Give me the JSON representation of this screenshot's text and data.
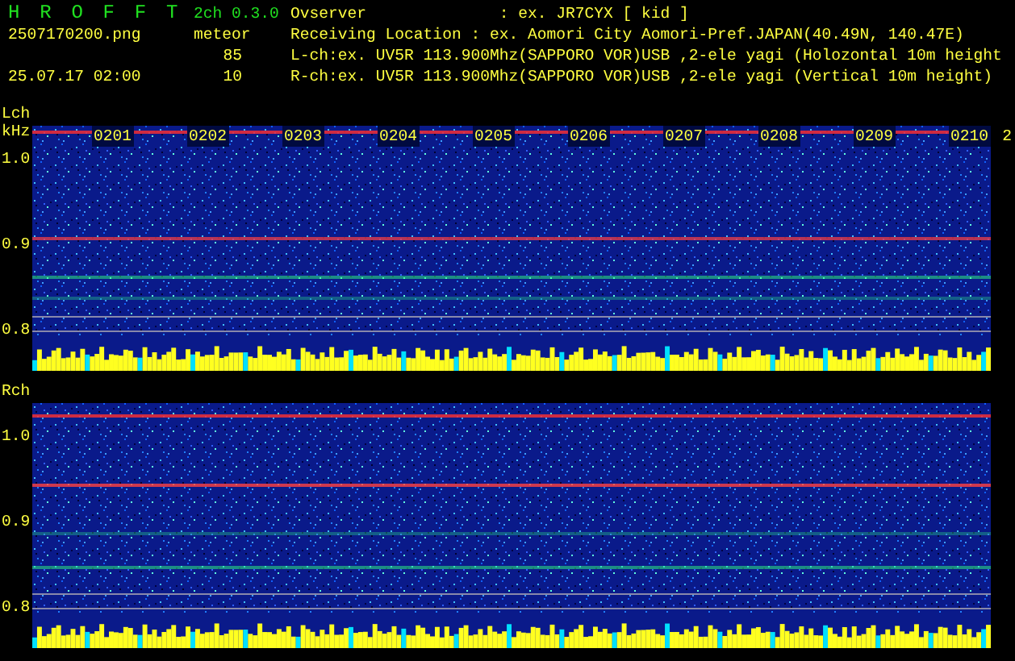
{
  "header": {
    "title": "H R O F F T",
    "version": "2ch 0.3.0",
    "file": "2507170200.png",
    "timestamp": "25.07.17 02:00"
  },
  "meteor": {
    "label": "meteor",
    "counts": [
      "85",
      "10"
    ]
  },
  "info": [
    "Ovserver              : ex. JR7CYX [ kid ]",
    "Receiving Location : ex. Aomori City Aomori-Pref.JAPAN(40.49N, 140.47E)",
    "L-ch:ex. UV5R 113.900Mhz(SAPPORO VOR)USB ,2-ele yagi (Holozontal 10m height",
    "R-ch:ex. UV5R 113.900Mhz(SAPPORO VOR)USB ,2-ele yagi (Vertical 10m height)"
  ],
  "channels": [
    {
      "name": "Lch",
      "unit": "kHz",
      "freq_labels": [
        "1.0",
        "0.9",
        "0.8"
      ],
      "time_labels": [
        "0201",
        "0202",
        "0203",
        "0204",
        "0205",
        "0206",
        "0207",
        "0208",
        "0209",
        "0210"
      ],
      "edge_label": "2"
    },
    {
      "name": "Rch",
      "freq_labels": [
        "1.0",
        "0.9",
        "0.8"
      ]
    }
  ]
}
